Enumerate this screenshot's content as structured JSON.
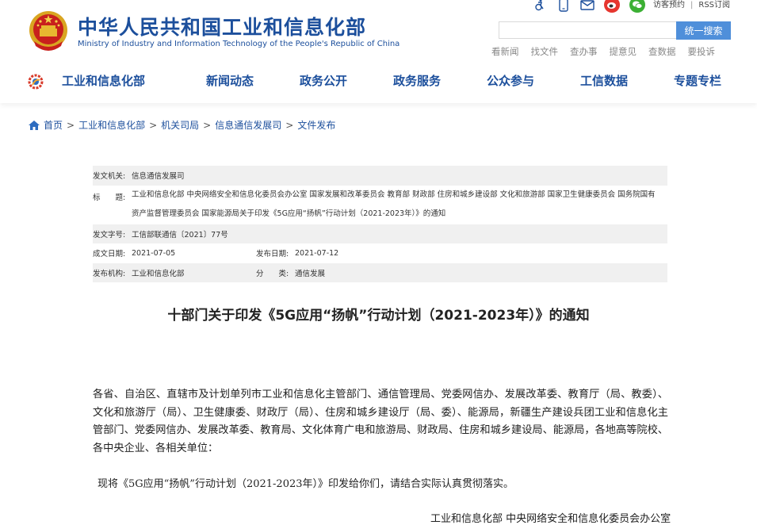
{
  "header": {
    "ministry_cn": "中华人民共和国工业和信息化部",
    "ministry_en": "Ministry of Industry and Information Technology of the People's Republic of China",
    "top_links": [
      "访客预约",
      "RSS订阅"
    ],
    "search": {
      "placeholder": "",
      "button_label": "统一搜索"
    },
    "quick_links": [
      "看新闻",
      "找文件",
      "查办事",
      "提意见",
      "查数据",
      "要投诉"
    ],
    "icons": [
      "accessibility-icon",
      "mobile-icon",
      "mail-icon",
      "weibo-icon",
      "wechat-icon"
    ]
  },
  "nav": {
    "items": [
      "工业和信息化部",
      "新闻动态",
      "政务公开",
      "政务服务",
      "公众参与",
      "工信数据",
      "专题专栏"
    ]
  },
  "breadcrumb": [
    "首页",
    "工业和信息化部",
    "机关司局",
    "信息通信发展司",
    "文件发布"
  ],
  "meta": {
    "issuer_label": "发文机关:",
    "issuer": "信息通信发展司",
    "title_label": "标　　题:",
    "title_line1": "工业和信息化部 中央网络安全和信息化委员会办公室 国家发展和改革委员会 教育部 财政部 住房和城乡建设部 文化和旅游部 国家卫生健康委员会 国务院国有",
    "title_line2": "资产监督管理委员会 国家能源局关于印发《5G应用“扬帆”行动计划（2021-2023年）》的通知",
    "doc_no_label": "发文字号:",
    "doc_no": "工信部联通信〔2021〕77号",
    "written_date_label": "成文日期:",
    "written_date": "2021-07-05",
    "publish_date_label": "发布日期:",
    "publish_date": "2021-07-12",
    "org_label": "发布机构:",
    "org": "工业和信息化部",
    "category_label": "分　　类:",
    "category": "通信发展"
  },
  "doc": {
    "title": "十部门关于印发《5G应用“扬帆”行动计划（2021-2023年）》的通知",
    "para1": "各省、自治区、直辖市及计划单列市工业和信息化主管部门、通信管理局、党委网信办、发展改革委、教育厅（局、教委）、文化和旅游厅（局）、卫生健康委、财政厅（局）、住房和城乡建设厅（局、委）、能源局，新疆生产建设兵团工业和信息化主管部门、党委网信办、发展改革委、教育局、文化体育广电和旅游局、财政局、住房和城乡建设局、能源局，各地高等院校、各中央企业、各相关单位：",
    "para2": "现将《5G应用“扬帆”行动计划（2021-2023年）》印发给你们，请结合实际认真贯彻落实。",
    "sign": "工业和信息化部 中央网络安全和信息化委员会办公室"
  },
  "colors": {
    "brand_blue": "#1c4f9c",
    "search_button": "#4f8fda",
    "meta_shade": "#f0f0f0"
  }
}
